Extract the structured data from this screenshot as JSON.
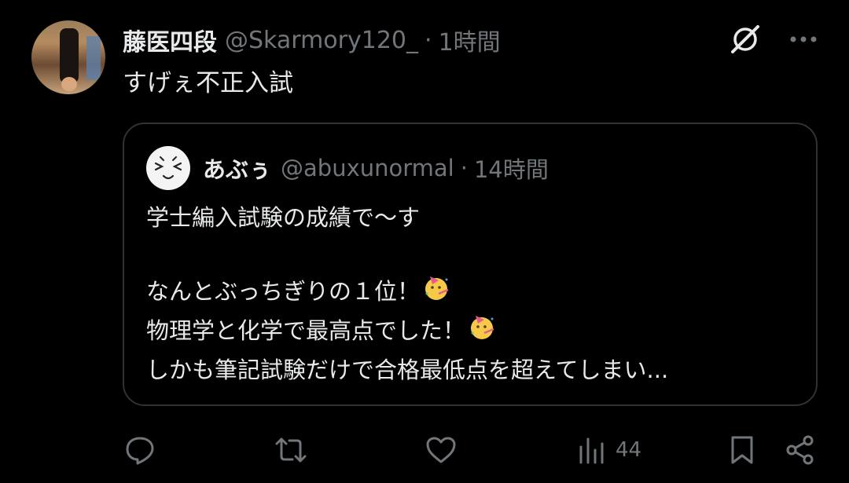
{
  "tweet": {
    "author_name": "藤医四段",
    "author_handle": "@Skarmory120_",
    "separator": "·",
    "time": "1時間",
    "text": "すげぇ不正入試"
  },
  "quoted": {
    "author_name": "あぶぅ",
    "author_handle": "@abuxunormal",
    "separator": "·",
    "time": "14時間",
    "lines": [
      "学士編入試験の成績で〜す",
      "",
      "なんとぶっちぎりの１位！",
      "物理学と化学で最高点でした！",
      "しかも筆記試験だけで合格最低点を超えてしまい..."
    ]
  },
  "actions": {
    "views": "44"
  },
  "icons": {
    "top": [
      "grok-icon",
      "more-icon"
    ],
    "bar": [
      "reply-icon",
      "retweet-icon",
      "like-icon",
      "views-icon",
      "bookmark-icon",
      "share-icon"
    ],
    "emoji": "partying-face-emoji"
  },
  "colors": {
    "background": "#000000",
    "text": "#e7e9ea",
    "secondary": "#71767b",
    "border": "#2f3336"
  }
}
